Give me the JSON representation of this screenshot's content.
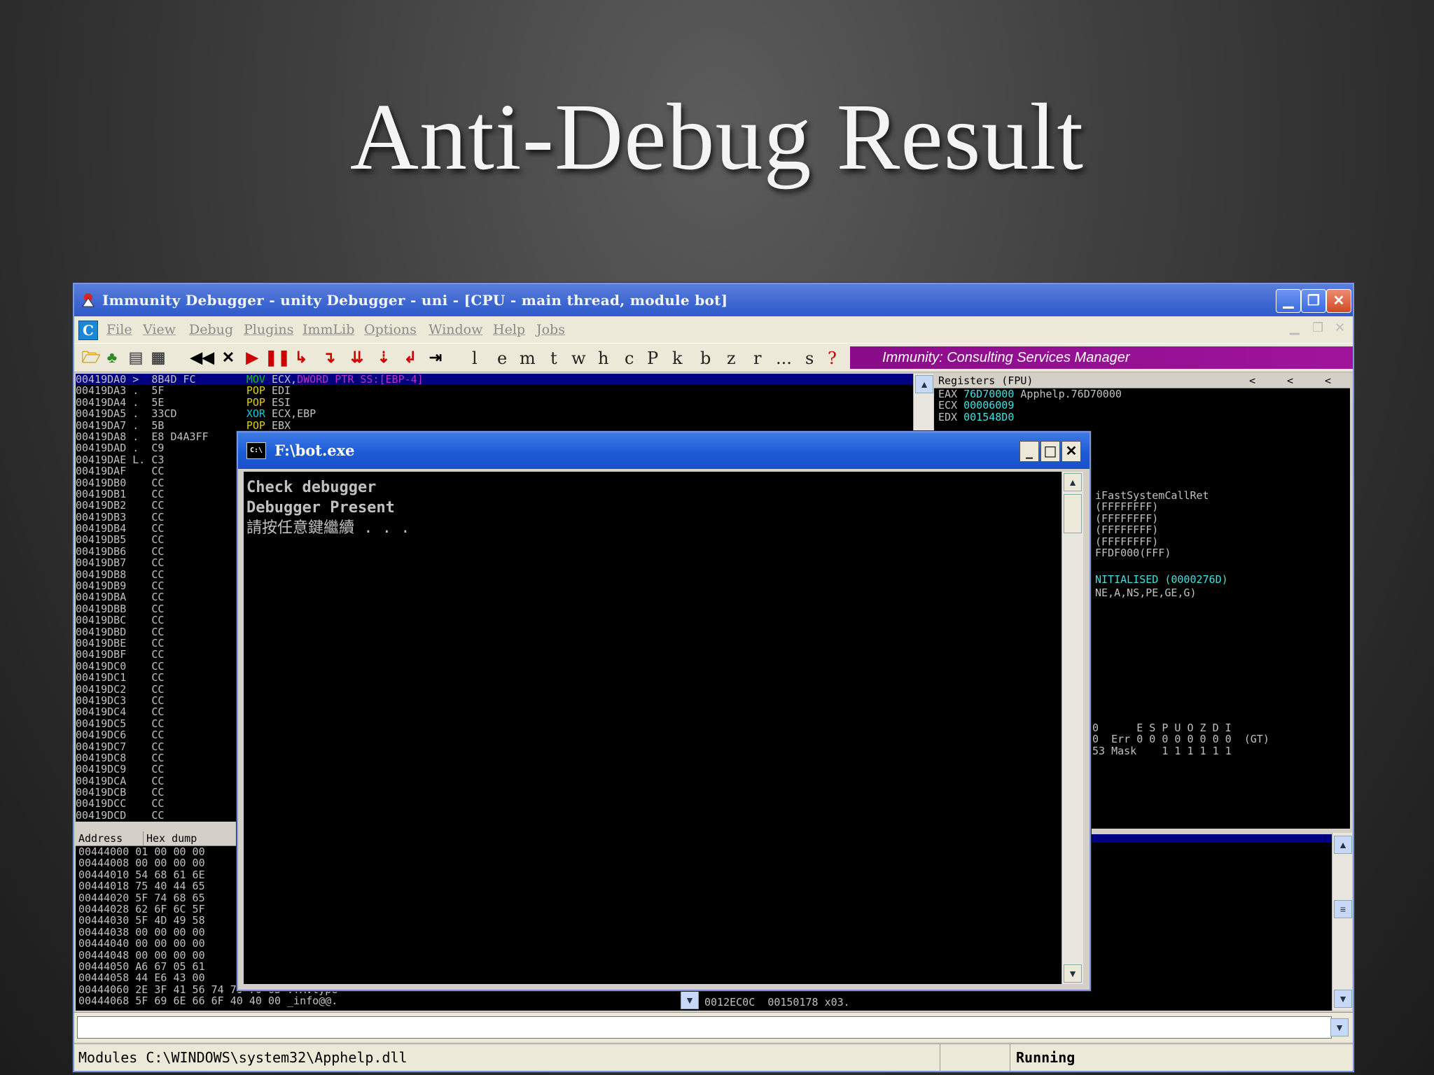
{
  "slide": {
    "title": "Anti-Debug Result"
  },
  "window": {
    "title": "Immunity Debugger - unity Debugger - uni - [CPU - main thread, module bot]",
    "controls": {
      "minimize": "▁",
      "restore": "❐",
      "close": "✕"
    }
  },
  "menu": {
    "icon_letter": "C",
    "items": [
      "File",
      "View",
      "Debug",
      "Plugins",
      "ImmLib",
      "Options",
      "Window",
      "Help",
      "Jobs"
    ]
  },
  "toolbar": {
    "letters": [
      "l",
      "e",
      "m",
      "t",
      "w",
      "h",
      "c",
      "P",
      "k",
      "b",
      "z",
      "r",
      "...",
      "s",
      "?"
    ],
    "banner": "Immunity: Consulting Services Manager"
  },
  "disasm": {
    "rows": [
      {
        "addr": "00419DA0",
        "mark": ">",
        "hex": "8B4D FC",
        "mn": "MOV",
        "ops": "ECX,",
        "ops2": "DWORD PTR SS:[EBP-4]",
        "kind": "mov"
      },
      {
        "addr": "00419DA3",
        "mark": ".",
        "hex": "5F",
        "mn": "POP",
        "ops": "EDI",
        "kind": "pop"
      },
      {
        "addr": "00419DA4",
        "mark": ".",
        "hex": "5E",
        "mn": "POP",
        "ops": "ESI",
        "kind": "pop"
      },
      {
        "addr": "00419DA5",
        "mark": ".",
        "hex": "33CD",
        "mn": "XOR",
        "ops": "ECX,EBP",
        "kind": "xor"
      },
      {
        "addr": "00419DA7",
        "mark": ".",
        "hex": "5B",
        "mn": "POP",
        "ops": "EBX",
        "kind": "pop"
      },
      {
        "addr": "00419DA8",
        "mark": ".",
        "hex": "E8 D4A3FF",
        "mn": "",
        "ops": "",
        "kind": ""
      },
      {
        "addr": "00419DAD",
        "mark": ".",
        "hex": "C9",
        "mn": "",
        "ops": "",
        "kind": ""
      },
      {
        "addr": "00419DAE",
        "mark": "L.",
        "hex": "C3",
        "mn": "",
        "ops": "",
        "kind": ""
      },
      {
        "addr": "00419DAF",
        "mark": "",
        "hex": "CC",
        "mn": "",
        "ops": "",
        "kind": ""
      },
      {
        "addr": "00419DB0",
        "mark": "",
        "hex": "CC",
        "mn": "",
        "ops": "",
        "kind": ""
      },
      {
        "addr": "00419DB1",
        "mark": "",
        "hex": "CC",
        "mn": "",
        "ops": "",
        "kind": ""
      },
      {
        "addr": "00419DB2",
        "mark": "",
        "hex": "CC",
        "mn": "",
        "ops": "",
        "kind": ""
      },
      {
        "addr": "00419DB3",
        "mark": "",
        "hex": "CC",
        "mn": "",
        "ops": "",
        "kind": ""
      },
      {
        "addr": "00419DB4",
        "mark": "",
        "hex": "CC",
        "mn": "",
        "ops": "",
        "kind": ""
      },
      {
        "addr": "00419DB5",
        "mark": "",
        "hex": "CC",
        "mn": "",
        "ops": "",
        "kind": ""
      },
      {
        "addr": "00419DB6",
        "mark": "",
        "hex": "CC",
        "mn": "",
        "ops": "",
        "kind": ""
      },
      {
        "addr": "00419DB7",
        "mark": "",
        "hex": "CC",
        "mn": "",
        "ops": "",
        "kind": ""
      },
      {
        "addr": "00419DB8",
        "mark": "",
        "hex": "CC",
        "mn": "",
        "ops": "",
        "kind": ""
      },
      {
        "addr": "00419DB9",
        "mark": "",
        "hex": "CC",
        "mn": "",
        "ops": "",
        "kind": ""
      },
      {
        "addr": "00419DBA",
        "mark": "",
        "hex": "CC",
        "mn": "",
        "ops": "",
        "kind": ""
      },
      {
        "addr": "00419DBB",
        "mark": "",
        "hex": "CC",
        "mn": "",
        "ops": "",
        "kind": ""
      },
      {
        "addr": "00419DBC",
        "mark": "",
        "hex": "CC",
        "mn": "",
        "ops": "",
        "kind": ""
      },
      {
        "addr": "00419DBD",
        "mark": "",
        "hex": "CC",
        "mn": "",
        "ops": "",
        "kind": ""
      },
      {
        "addr": "00419DBE",
        "mark": "",
        "hex": "CC",
        "mn": "",
        "ops": "",
        "kind": ""
      },
      {
        "addr": "00419DBF",
        "mark": "",
        "hex": "CC",
        "mn": "",
        "ops": "",
        "kind": ""
      },
      {
        "addr": "00419DC0",
        "mark": "",
        "hex": "CC",
        "mn": "",
        "ops": "",
        "kind": ""
      },
      {
        "addr": "00419DC1",
        "mark": "",
        "hex": "CC",
        "mn": "",
        "ops": "",
        "kind": ""
      },
      {
        "addr": "00419DC2",
        "mark": "",
        "hex": "CC",
        "mn": "",
        "ops": "",
        "kind": ""
      },
      {
        "addr": "00419DC3",
        "mark": "",
        "hex": "CC",
        "mn": "",
        "ops": "",
        "kind": ""
      },
      {
        "addr": "00419DC4",
        "mark": "",
        "hex": "CC",
        "mn": "",
        "ops": "",
        "kind": ""
      },
      {
        "addr": "00419DC5",
        "mark": "",
        "hex": "CC",
        "mn": "",
        "ops": "",
        "kind": ""
      },
      {
        "addr": "00419DC6",
        "mark": "",
        "hex": "CC",
        "mn": "",
        "ops": "",
        "kind": ""
      },
      {
        "addr": "00419DC7",
        "mark": "",
        "hex": "CC",
        "mn": "",
        "ops": "",
        "kind": ""
      },
      {
        "addr": "00419DC8",
        "mark": "",
        "hex": "CC",
        "mn": "",
        "ops": "",
        "kind": ""
      },
      {
        "addr": "00419DC9",
        "mark": "",
        "hex": "CC",
        "mn": "",
        "ops": "",
        "kind": ""
      },
      {
        "addr": "00419DCA",
        "mark": "",
        "hex": "CC",
        "mn": "",
        "ops": "",
        "kind": ""
      },
      {
        "addr": "00419DCB",
        "mark": "",
        "hex": "CC",
        "mn": "",
        "ops": "",
        "kind": ""
      },
      {
        "addr": "00419DCC",
        "mark": "",
        "hex": "CC",
        "mn": "",
        "ops": "",
        "kind": ""
      },
      {
        "addr": "00419DCD",
        "mark": "",
        "hex": "CC",
        "mn": "",
        "ops": "",
        "kind": ""
      }
    ]
  },
  "registers": {
    "header": "Registers (FPU)",
    "nav": [
      "<",
      "<",
      "<"
    ],
    "lines": [
      {
        "name": "EAX",
        "val": "76D70000",
        "note": "Apphelp.76D70000"
      },
      {
        "name": "ECX",
        "val": "00006009",
        "note": ""
      },
      {
        "name": "EDX",
        "val": "001548D0",
        "note": ""
      }
    ],
    "partial": [
      {
        "text": "iFastSystemCallRet",
        "cls": ""
      },
      {
        "text": "(FFFFFFFF)",
        "cls": ""
      },
      {
        "text": "(FFFFFFFF)",
        "cls": ""
      },
      {
        "text": "(FFFFFFFF)",
        "cls": ""
      },
      {
        "text": "(FFFFFFFF)",
        "cls": ""
      },
      {
        "text": "FFDF000(FFF)",
        "cls": ""
      },
      {
        "text": "NITIALISED (0000276D)",
        "cls": "cyan"
      },
      {
        "text": "NE,A,NS,PE,GE,G)",
        "cls": ""
      }
    ],
    "fpu": [
      "0      E S P U O Z D I",
      "0  Err 0 0 0 0 0 0 0 0  (GT)",
      "53 Mask    1 1 1 1 1 1"
    ]
  },
  "dump": {
    "col_address": "Address",
    "col_hex": "Hex dump",
    "rows": [
      {
        "addr": "00444000",
        "hex": "01 00 00 00",
        "ascii": ""
      },
      {
        "addr": "00444008",
        "hex": "00 00 00 00",
        "ascii": ""
      },
      {
        "addr": "00444010",
        "hex": "54 68 61 6E",
        "ascii": ""
      },
      {
        "addr": "00444018",
        "hex": "75 40 44 65",
        "ascii": ""
      },
      {
        "addr": "00444020",
        "hex": "5F 74 68 65",
        "ascii": ""
      },
      {
        "addr": "00444028",
        "hex": "62 6F 6C 5F",
        "ascii": ""
      },
      {
        "addr": "00444030",
        "hex": "5F 4D 49 58",
        "ascii": ""
      },
      {
        "addr": "00444038",
        "hex": "00 00 00 00",
        "ascii": ""
      },
      {
        "addr": "00444040",
        "hex": "00 00 00 00",
        "ascii": ""
      },
      {
        "addr": "00444048",
        "hex": "00 00 00 00",
        "ascii": ""
      },
      {
        "addr": "00444050",
        "hex": "A6 67 05 61",
        "ascii": ""
      },
      {
        "addr": "00444058",
        "hex": "44 E6 43 00",
        "ascii": ""
      },
      {
        "addr": "00444060",
        "hex": "2E 3F 41 56 74 79 70 65",
        "ascii": ".?AVtype"
      },
      {
        "addr": "00444068",
        "hex": "5F 69 6E 66 6F 40 40 00",
        "ascii": "_info@@."
      }
    ]
  },
  "stack": {
    "rows": [
      {
        "addr": "0012EC0C",
        "val": "00150178",
        "note": "x03."
      }
    ]
  },
  "console": {
    "title": "F:\\bot.exe",
    "icon": "C:\\",
    "lines": [
      "Check debugger",
      "Debugger Present",
      "請按任意鍵繼續 . . ."
    ]
  },
  "status": {
    "text": "Modules C:\\WINDOWS\\system32\\Apphelp.dll",
    "state": "Running"
  }
}
